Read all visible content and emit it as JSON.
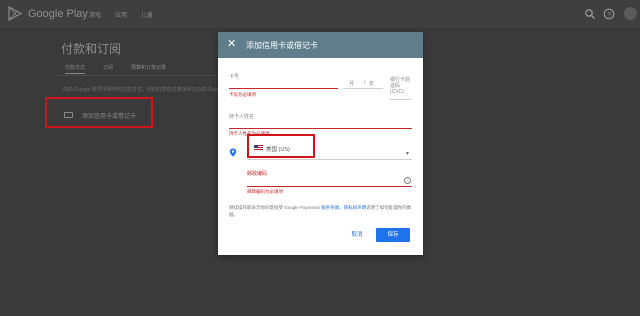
{
  "topbar": {
    "brand": "Google Play",
    "nav": [
      "游戏",
      "应用",
      "儿童"
    ],
    "search_icon": "search-icon",
    "help_icon": "help-icon",
    "avatar_icon": "avatar-icon"
  },
  "background": {
    "title": "付款和订阅",
    "tabs": [
      "付款方式",
      "订阅",
      "预算和订单记录"
    ],
    "description": "你的 Google 账号中保存的付款方式。你的付款信息将保存在你的 Google 账号中",
    "add_card_label": "添加信用卡或借记卡",
    "card_icon": "credit-card-icon"
  },
  "dialog": {
    "title": "添加信用卡或借记卡",
    "close_icon": "close-icon",
    "card_number": {
      "label": "卡号",
      "error": "卡号为必填项"
    },
    "expiry": {
      "month": "月",
      "sep": "/",
      "year": "年"
    },
    "cvc": {
      "label": "银行卡验证码 (CVC)"
    },
    "cardholder": {
      "label": "持卡人姓名",
      "error": "持卡人姓名为必填项"
    },
    "country": {
      "value": "美国 (US)",
      "icon": "location-pin-icon",
      "flag": "us-flag-icon"
    },
    "postal": {
      "label": "邮政编码",
      "error": "邮政编码为必填项",
      "help_icon": "help-circle-icon"
    },
    "terms": {
      "prefix": "继续操作即表示你同意接受 Google Payments ",
      "link1": "服务条款",
      "middle": "。",
      "link2": "隐私权声明",
      "suffix": "说明了如何处理你的数据。"
    },
    "cancel_label": "取消",
    "save_label": "保存"
  },
  "colors": {
    "header": "#607d8b",
    "error": "#c62828",
    "primary": "#1e73e8",
    "highlight": "#d2151b"
  }
}
